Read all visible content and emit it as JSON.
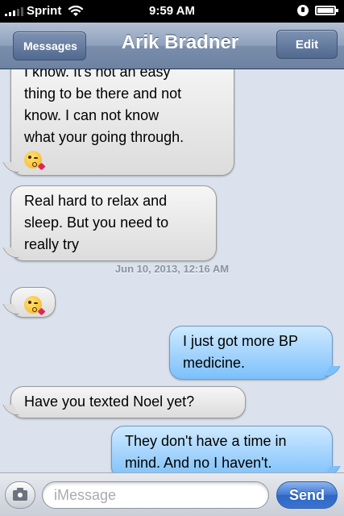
{
  "status_bar": {
    "carrier": "Sprint",
    "time": "9:59 AM",
    "icons": [
      "signal-icon",
      "wifi-icon",
      "rotation-lock-icon",
      "battery-icon"
    ],
    "battery_level": 0.9
  },
  "nav": {
    "back_label": "Messages",
    "title": "Arik Bradner",
    "edit_label": "Edit"
  },
  "messages": [
    {
      "direction": "incoming",
      "lines": [
        "I know.  It's not an easy",
        "thing to be there and not",
        "know.  I can not know",
        "what your going through."
      ],
      "emoji": "kissing-heart-emoji"
    },
    {
      "direction": "incoming",
      "lines": [
        "Real hard to relax and",
        "sleep.  But you need to",
        "really try"
      ]
    },
    {
      "direction": "incoming",
      "emoji": "kissing-heart-emoji"
    },
    {
      "direction": "outgoing",
      "lines": [
        "I just got more BP",
        "medicine."
      ]
    },
    {
      "direction": "incoming",
      "lines": [
        "Have you texted Noel yet?"
      ]
    },
    {
      "direction": "outgoing",
      "lines": [
        "They don't have a time in",
        "mind. And no I haven't."
      ]
    }
  ],
  "timestamp": "Jun 10, 2013, 12:16 AM",
  "input": {
    "placeholder": "iMessage",
    "value": "",
    "send_label": "Send"
  },
  "colors": {
    "background": "#dbe2ed",
    "incoming_bubble": "#e8e8e8",
    "outgoing_bubble": "#9fd0fc",
    "nav_bar": "#7a8eab",
    "send_button": "#3a74d0"
  }
}
